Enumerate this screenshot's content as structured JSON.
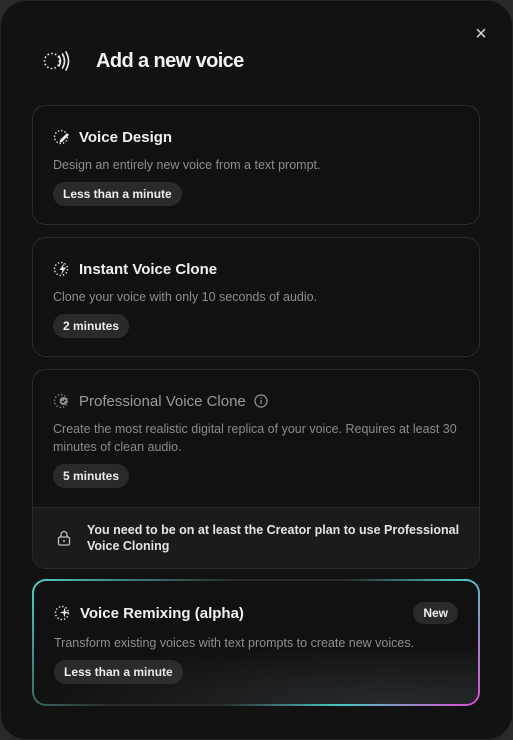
{
  "dialog": {
    "title": "Add a new voice",
    "close_label": "×"
  },
  "options": [
    {
      "title": "Voice Design",
      "description": "Design an entirely new voice from a text prompt.",
      "duration": "Less than a minute",
      "icon": "sparkle-pen-icon"
    },
    {
      "title": "Instant Voice Clone",
      "description": "Clone your voice with only 10 seconds of audio.",
      "duration": "2 minutes",
      "icon": "sparkle-bolt-icon"
    },
    {
      "title": "Professional Voice Clone",
      "description": "Create the most realistic digital replica of your voice. Requires at least 30 minutes of clean audio.",
      "duration": "5 minutes",
      "icon": "sparkle-badge-icon",
      "locked_message": "You need to be on at least the Creator plan to use Professional Voice Cloning"
    },
    {
      "title": "Voice Remixing (alpha)",
      "description": "Transform existing voices with text prompts to create new voices.",
      "duration": "Less than a minute",
      "badge": "New",
      "icon": "sparkle-icon"
    }
  ],
  "colors": {
    "background": "#121212",
    "card_border": "#2c2c2c",
    "pill_bg": "#2a2a2a",
    "gradient_teal": "#4fd1c5",
    "gradient_pink": "#e24bd1"
  }
}
